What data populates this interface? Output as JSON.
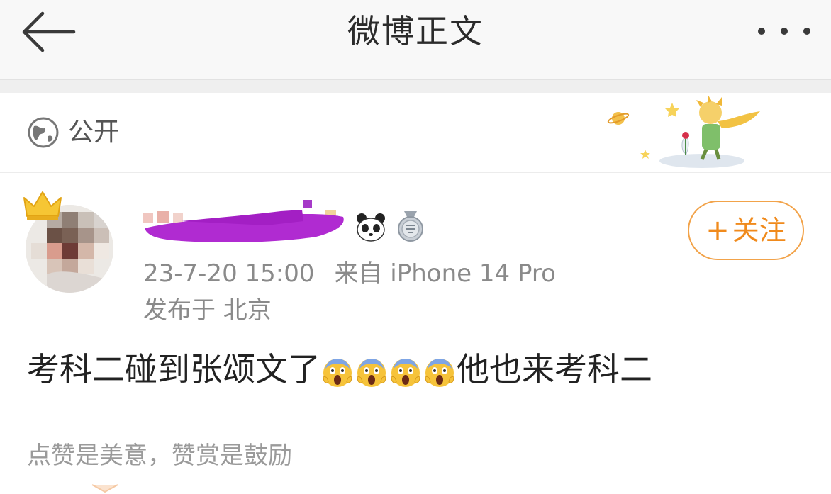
{
  "nav": {
    "title": "微博正文",
    "back_icon": "arrow-left-icon",
    "more_icon": "more-dots-icon"
  },
  "visibility": {
    "icon": "globe-icon",
    "label": "公开"
  },
  "author": {
    "name": "",
    "badges": [
      "panda-icon",
      "medal-icon"
    ],
    "timestamp": "23-7-20 15:00",
    "source": "来自 iPhone 14 Pro",
    "location": "发布于 北京"
  },
  "follow_button": {
    "plus": "+",
    "label": "关注"
  },
  "post": {
    "text_before": "考科二碰到张颂文了",
    "emoji_count": 4,
    "emoji_icon": "scream-emoji-icon",
    "text_after": "他也来考科二"
  },
  "footer": {
    "reward_text": "点赞是美意，赞赏是鼓励"
  },
  "colors": {
    "accent": "#f08a1c",
    "follow_border": "#f2a34a",
    "meta_text": "#8a8a8a",
    "redaction": "#b02bd1"
  }
}
